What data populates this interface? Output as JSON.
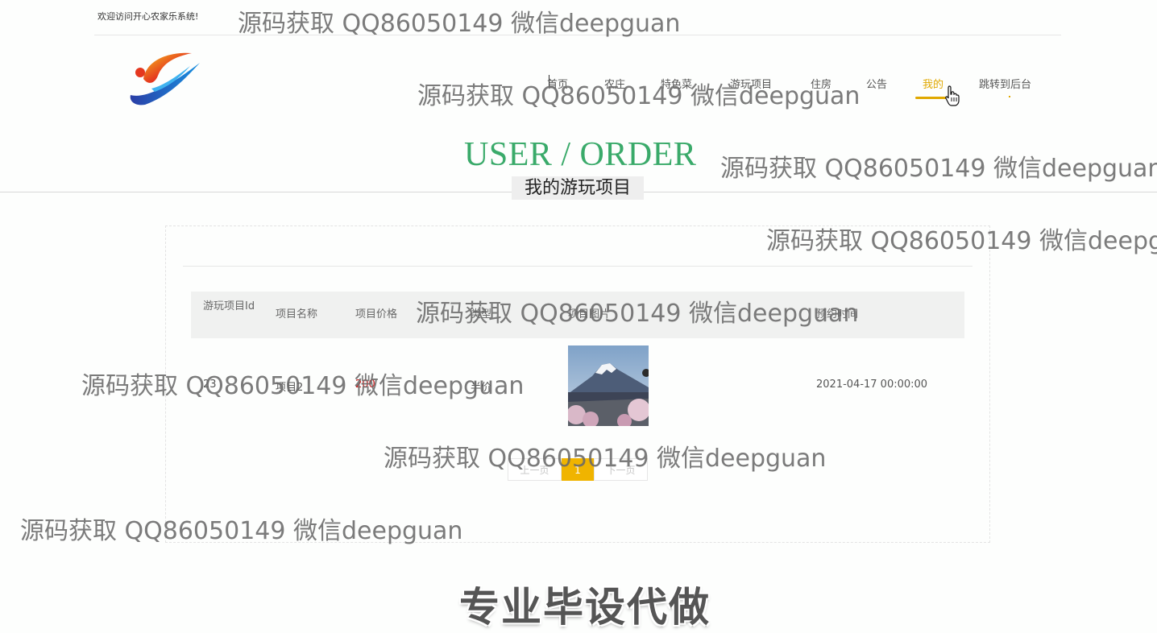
{
  "topbar": {
    "welcome": "欢迎访问开心农家乐系统!"
  },
  "nav": {
    "items": [
      {
        "label": "首页"
      },
      {
        "label": "农庄"
      },
      {
        "label": "特色菜"
      },
      {
        "label": "游玩项目"
      },
      {
        "label": "住房"
      },
      {
        "label": "公告"
      },
      {
        "label": "我的"
      },
      {
        "label": "跳转到后台"
      }
    ],
    "active_color": "#e0a800"
  },
  "title": {
    "en": "USER / ORDER",
    "cn": "我的游玩项目",
    "en_color": "#3aaa6a"
  },
  "table": {
    "headers": [
      "游玩项目Id",
      "项目名称",
      "项目价格",
      "类型",
      "项目图片",
      "预约时间"
    ],
    "rows": [
      {
        "id": "23",
        "name": "项目2",
        "price": "200",
        "type": "半价",
        "image": "mountain-photo",
        "time": "2021-04-17 00:00:00"
      }
    ]
  },
  "pagination": {
    "prev": "上一页",
    "current": "1",
    "next": "下一页",
    "accent": "#f0b400"
  },
  "watermarks": [
    "源码获取 QQ86050149 微信deepguan",
    "源码获取 QQ86050149 微信deepguan",
    "源码获取 QQ86050149 微信deepguan",
    "源码获取 QQ86050149 微信deepgu",
    "源码获取 QQ86050149 微信deepguan",
    "源码获取 QQ86050149 微信deepguan",
    "源码获取 QQ86050149 微信deepguan",
    "源码获取 QQ86050149 微信deepguan"
  ],
  "banner": "专业毕设代做"
}
